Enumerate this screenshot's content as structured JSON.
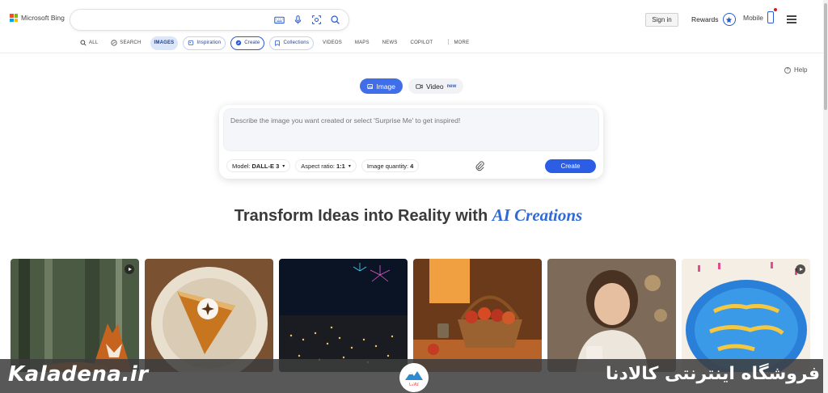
{
  "header": {
    "logo_text": "Microsoft Bing",
    "search": {
      "value": "",
      "placeholder": ""
    },
    "signin_label": "Sign in",
    "rewards_label": "Rewards",
    "mobile_label": "Mobile"
  },
  "nav": {
    "items": [
      {
        "label": "ALL",
        "icon": "search-icon"
      },
      {
        "label": "SEARCH",
        "icon": "copilot-search-icon"
      },
      {
        "label": "IMAGES",
        "active": true
      },
      {
        "label": "Inspiration",
        "icon": "inspiration-icon"
      },
      {
        "label": "Create",
        "icon": "create-icon"
      },
      {
        "label": "Collections",
        "icon": "collections-icon"
      },
      {
        "label": "VIDEOS"
      },
      {
        "label": "MAPS"
      },
      {
        "label": "NEWS"
      },
      {
        "label": "COPILOT"
      },
      {
        "label": "MORE",
        "icon": "more-dots-icon"
      }
    ]
  },
  "help_label": "Help",
  "mode_tabs": {
    "image_label": "Image",
    "video_label": "Video",
    "video_badge": "new"
  },
  "prompt": {
    "placeholder": "Describe the image you want created or select 'Surprise Me' to get inspired!",
    "value": ""
  },
  "options": {
    "model_label": "Model:",
    "model_value": "DALL-E 3",
    "aspect_label": "Aspect ratio:",
    "aspect_value": "1:1",
    "quantity_label": "Image quantity:",
    "quantity_value": "4"
  },
  "create_label": "Create",
  "heading": {
    "main": "Transform Ideas into Reality with",
    "accent": "AI Creations"
  },
  "gallery": [
    {
      "subject": "fox in forest",
      "video": true
    },
    {
      "subject": "pumpkin pie slice",
      "video": false
    },
    {
      "subject": "city at night with fireworks",
      "video": false
    },
    {
      "subject": "basket of apples",
      "video": false
    },
    {
      "subject": "woman with mug",
      "video": false
    },
    {
      "subject": "happy birthday cake",
      "video": true
    }
  ],
  "watermark": {
    "left_text": "Kaladena.ir",
    "right_text": "فروشگاه اینترنتی کالادنا",
    "logo_text": "کالادنا"
  },
  "colors": {
    "accent": "#3f6ee8",
    "brand_blue": "#2c5bd1",
    "heading_accent": "#2f6ad6"
  }
}
